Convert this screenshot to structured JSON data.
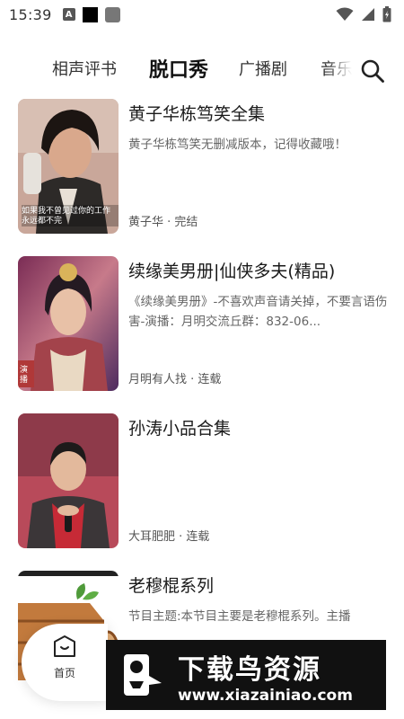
{
  "status_bar": {
    "time": "15:39",
    "notif_a": "A"
  },
  "tabs": {
    "items": [
      {
        "label": "相声评书"
      },
      {
        "label": "脱口秀"
      },
      {
        "label": "广播剧"
      },
      {
        "label": "音乐"
      }
    ],
    "active": "脱口秀"
  },
  "list": [
    {
      "title": "黄子华栋笃笑全集",
      "description": "黄子华栋笃笑无删减版本，记得收藏哦！",
      "meta": "黄子华 · 完结",
      "cover_caption": "如果我不曾见过你的工作永远都不完"
    },
    {
      "title": "续缘美男册|仙侠多夫(精品)",
      "description": "《续缘美男册》-不喜欢声音请关掉，不要言语伤害-演播：月明交流丘群：832-06...",
      "meta": "月明有人找 · 连载",
      "cover_caption": "演播"
    },
    {
      "title": "孙涛小品合集",
      "description": "",
      "meta": "大耳肥肥 · 连载"
    },
    {
      "title": "老穆棍系列",
      "description": "节目主题:本节目主要是老穆棍系列。主播"
    }
  ],
  "bottom_nav": {
    "home_label": "首页"
  },
  "watermark": {
    "title": "下载鸟资源",
    "url": "www.xiazainiao.com"
  },
  "colors": {
    "text_primary": "#1a1a1a",
    "text_secondary": "#666666",
    "watermark_bg": "#111111"
  }
}
